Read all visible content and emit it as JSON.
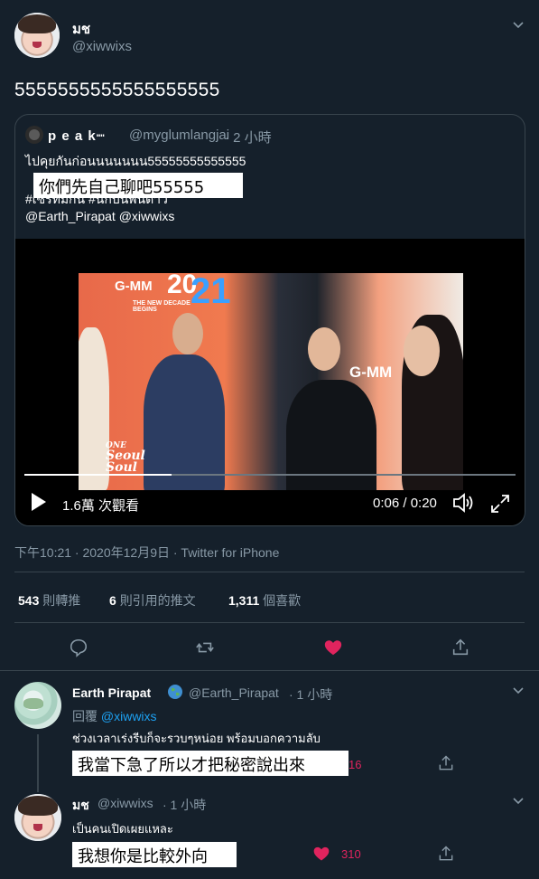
{
  "main_tweet": {
    "display_name": "มช",
    "handle": "@xiwwixs",
    "text": "5555555555555555555",
    "timestamp": "下午10:21 · 2020年12月9日 · Twitter for iPhone",
    "stats": {
      "retweets_num": "543",
      "retweets_label": "則轉推",
      "quotes_num": "6",
      "quotes_label": "則引用的推文",
      "likes_num": "1,311",
      "likes_label": "個喜歡"
    }
  },
  "quoted_tweet": {
    "display_name": "p e a k┉",
    "handle": "@myglumlangjai",
    "time": "· 2 小時",
    "line1": "ไปคุยกันก่อนนนนนนน55555555555555",
    "line2": "#เซรีทีมกัน #นักบินพันดาว",
    "line3": "@Earth_Pirapat @xiwwixs",
    "overlay": "你們先自己聊吧55555",
    "video": {
      "views": "1.6萬 次觀看",
      "time": "0:06 / 0:20",
      "progress": 0.3,
      "backdrop_gmm": "G-MM",
      "backdrop_20": "20",
      "backdrop_21": "21",
      "backdrop_sub": "THE NEW DECADE BEGINS",
      "backdrop_gmm2": "G-MM",
      "watermark_1": "ONE",
      "watermark_2": "Seoul",
      "watermark_3": "Soul"
    }
  },
  "reply1": {
    "display_name": "Earth Pirapat",
    "handle": "@Earth_Pirapat",
    "time": "· 1 小時",
    "reply_label": "回覆",
    "reply_to": "@xiwwixs",
    "text": "ช่วงเวลาเร่งรีบก็จะรวบๆหน่อย พร้อมบอกความลับ",
    "overlay": "我當下急了所以才把秘密說出來",
    "likes": "16"
  },
  "reply2": {
    "display_name": "มช",
    "handle": "@xiwwixs",
    "time": "· 1 小時",
    "text": "เป็นคนเปิดเผยแหละ",
    "overlay": "我想你是比較外向",
    "likes": "310"
  },
  "colors": {
    "background": "#15202b",
    "border": "#38444d",
    "muted": "#8899a6",
    "like": "#e0245e",
    "link": "#1da1f2"
  }
}
